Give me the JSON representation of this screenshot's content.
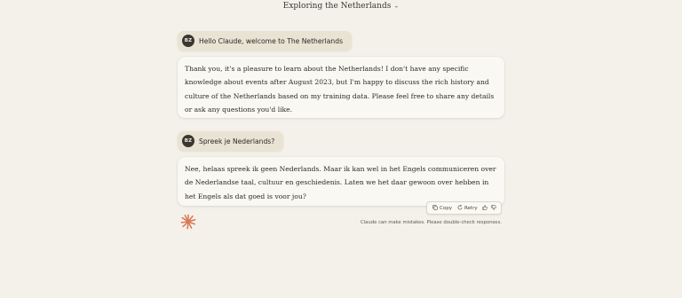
{
  "header": {
    "title": "Exploring the Netherlands"
  },
  "conversation": {
    "user_initials": "BZ",
    "messages": [
      {
        "role": "user",
        "text": "Hello Claude, welcome to The Netherlands"
      },
      {
        "role": "assistant",
        "text": "Thank you, it's a pleasure to learn about the Netherlands! I don't have any specific knowledge about events after August 2023, but I'm happy to discuss the rich history and culture of the Netherlands based on my training data. Please feel free to share any details or ask any questions you'd like."
      },
      {
        "role": "user",
        "text": "Spreek je Nederlands?"
      },
      {
        "role": "assistant",
        "text": "Nee, helaas spreek ik geen Nederlands. Maar ik kan wel in het Engels communiceren over de Nederlandse taal, cultuur en geschiedenis. Laten we het daar gewoon over hebben in het Engels als dat goed is voor jou?"
      }
    ]
  },
  "actions": {
    "copy_label": "Copy",
    "retry_label": "Retry",
    "copy_icon": "copy-icon",
    "retry_icon": "retry-icon",
    "thumbs_up_icon": "thumbs-up-icon",
    "thumbs_down_icon": "thumbs-down-icon"
  },
  "footer": {
    "disclaimer": "Claude can make mistakes. Please double-check responses."
  },
  "colors": {
    "background": "#f4f1ea",
    "user_bubble": "#e9e3d4",
    "assistant_bubble": "#faf8f3",
    "logo": "#d97757"
  }
}
